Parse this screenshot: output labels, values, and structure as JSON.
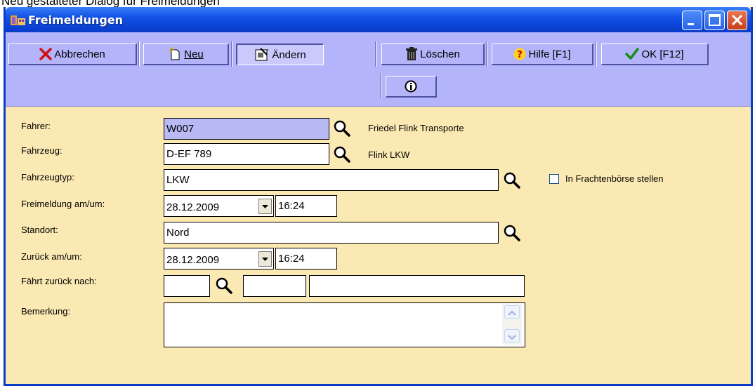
{
  "caption": "Neu gestalteter Dialog für Freimeldungen",
  "window": {
    "title": "Freimeldungen"
  },
  "toolbar": {
    "cancel_label": "Abbrechen",
    "new_label": "Neu",
    "edit_label": "Ändern",
    "delete_label": "Löschen",
    "help_label": "Hilfe [F1]",
    "ok_label": "OK [F12]"
  },
  "form": {
    "fahrer": {
      "label": "Fahrer:",
      "value": "W007",
      "info": "Friedel Flink Transporte"
    },
    "fahrzeug": {
      "label": "Fahrzeug:",
      "value": "D-EF 789",
      "info": "Flink LKW"
    },
    "fahrzeugtyp": {
      "label": "Fahrzeugtyp:",
      "value": "LKW",
      "checkbox_label": "In Frachtenbörse stellen"
    },
    "freimeldung": {
      "label": "Freimeldung am/um:",
      "date": "28.12.2009",
      "time": "16:24"
    },
    "standort": {
      "label": "Standort:",
      "value": "Nord"
    },
    "zurueck": {
      "label": "Zurück am/um:",
      "date": "28.12.2009",
      "time": "16:24"
    },
    "faehrt_zurueck": {
      "label": "Fährt zurück nach:"
    },
    "bemerkung": {
      "label": "Bemerkung:"
    }
  },
  "colors": {
    "titlebar": "#0a3cc7",
    "toolbar": "#b4b4fa",
    "form_background": "#fbe9b3",
    "active_field": "#b9b9f6"
  },
  "icons": {
    "app": "app-icon",
    "cancel": "x-icon",
    "new": "new-document-icon",
    "edit": "edit-icon",
    "delete": "trash-icon",
    "help": "question-icon",
    "ok": "checkmark-icon",
    "info": "info-icon",
    "search": "magnifier-icon"
  }
}
